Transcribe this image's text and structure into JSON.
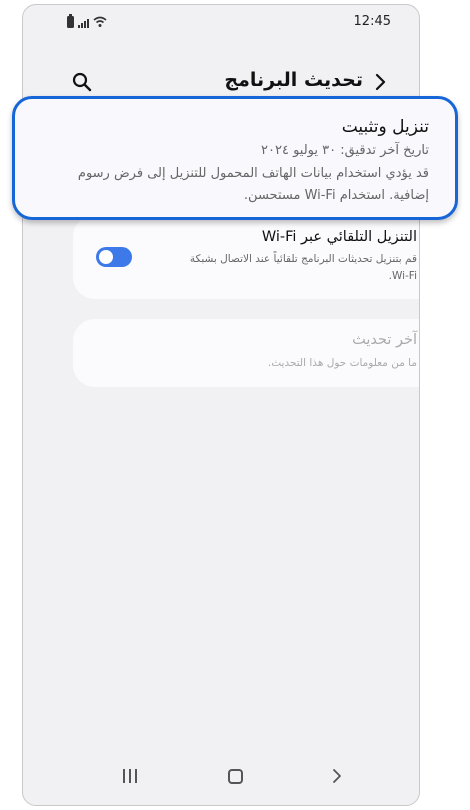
{
  "status_bar": {
    "time": "12:45",
    "icons": [
      "battery-icon",
      "signal-icon",
      "wifi-icon"
    ]
  },
  "header": {
    "title": "تحديث البرنامج",
    "icons": [
      "back-chevron-icon",
      "search-icon"
    ]
  },
  "popup": {
    "title": "تنزيل وتثبيت",
    "last_check": "تاريخ آخر تدقيق: ٣٠ يوليو ٢٠٢٤",
    "note": "قد يؤدي استخدام بيانات الهاتف المحمول للتنزيل إلى فرض رسوم إضافية. استخدام Wi-Fi مستحسن."
  },
  "auto_download": {
    "title": "التنزيل التلقائي عبر Wi-Fi",
    "description": "قم بتنزيل تحديثات البرنامج تلقائياً عند الاتصال بشبكة Wi-Fi.",
    "enabled": true
  },
  "last_update": {
    "title": "آخر تحديث",
    "description": "ما من معلومات حول هذا التحديث."
  },
  "nav_bar": {
    "icons": [
      "recent-apps-icon",
      "home-icon",
      "back-icon"
    ]
  },
  "colors": {
    "accent": "#1666d8",
    "toggle_on": "#3e79e9",
    "background": "#f1f1f4"
  }
}
